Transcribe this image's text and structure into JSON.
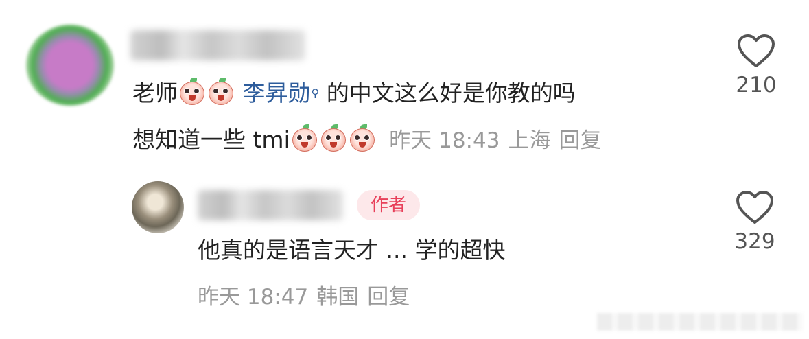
{
  "comment": {
    "text_prefix": "老师",
    "mention": "李昇勋",
    "text_suffix": "的中文这么好是你教的吗",
    "line2": "想知道一些 tmi",
    "meta": {
      "time": "昨天 18:43",
      "location": "上海",
      "reply": "回复"
    },
    "likes": "210",
    "emoji_name": "peach-face-emoji"
  },
  "reply": {
    "badge": "作者",
    "text": "他真的是语言天才 ... 学的超快",
    "meta": {
      "time": "昨天 18:47",
      "location": "韩国",
      "reply": "回复"
    },
    "likes": "329"
  },
  "icons": {
    "like": "heart-outline-icon"
  },
  "colors": {
    "mention": "#2e5d9c",
    "badge_text": "#e8405a",
    "badge_bg": "#fde8ea",
    "meta": "#999999"
  }
}
